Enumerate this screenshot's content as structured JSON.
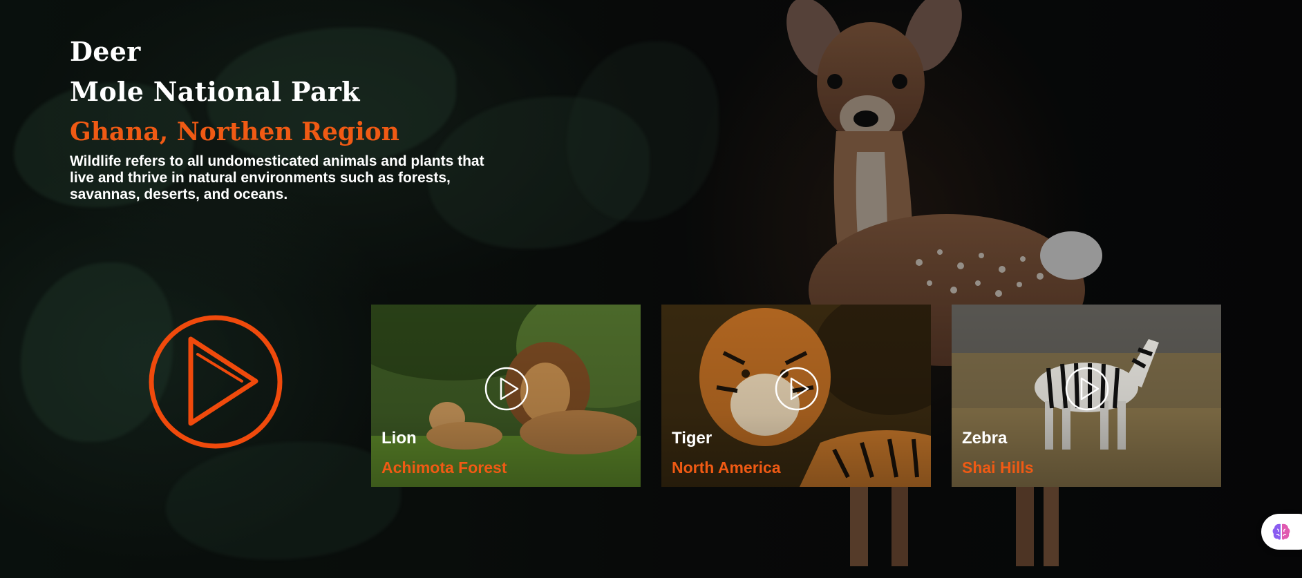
{
  "hero": {
    "title_line1": "Deer",
    "title_line2": "Mole National Park",
    "subtitle": "Ghana, Northen Region",
    "description": "Wildlife refers to all undomesticated animals and plants that live and thrive in natural environments such as forests, savannas, deserts, and oceans."
  },
  "cards": [
    {
      "name": "Lion",
      "location": "Achimota Forest",
      "icon": "play-icon"
    },
    {
      "name": "Tiger",
      "location": "North America",
      "icon": "play-icon"
    },
    {
      "name": "Zebra",
      "location": "Shai Hills",
      "icon": "play-icon"
    }
  ],
  "icons": {
    "big_play": "play-circle-icon",
    "assistant": "brain-icon"
  },
  "colors": {
    "accent": "#f05a14",
    "text": "#ffffff",
    "background": "#0b0d0c"
  }
}
